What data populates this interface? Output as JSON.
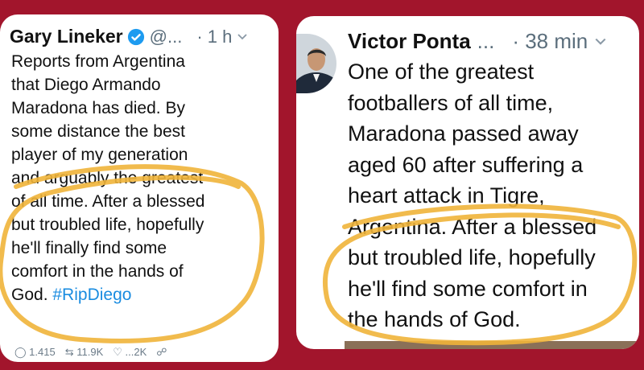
{
  "left_tweet": {
    "author_name": "Gary Lineker",
    "handle": "@...",
    "time": "· 1 h",
    "text_lines": [
      "Reports from Argentina",
      "that Diego Armando",
      "Maradona has died. By",
      "some distance the best",
      "player of my generation",
      "and arguably the greatest",
      "of all time. After a blessed",
      "but troubled life, hopefully",
      "he'll finally find some",
      "comfort in the hands of",
      "God."
    ],
    "hashtag": "#RipDiego",
    "actions": {
      "replies": "1.415",
      "retweets": "11.9K",
      "likes": "...2K"
    }
  },
  "right_tweet": {
    "author_name": "Victor Ponta",
    "handle": "...",
    "time": "· 38 min",
    "text_lines": [
      "One of the greatest",
      "footballers of all time,",
      "Maradona passed away",
      "aged 60 after suffering a",
      "heart attack in Tigre,",
      "Argentina. After a blessed",
      "but troubled life, hopefully",
      "he'll find some comfort in",
      "the hands of God."
    ]
  },
  "colors": {
    "background": "#a2152c",
    "highlight": "#f0b43a",
    "link": "#1a8ce0",
    "verified": "#1d9bf0"
  }
}
